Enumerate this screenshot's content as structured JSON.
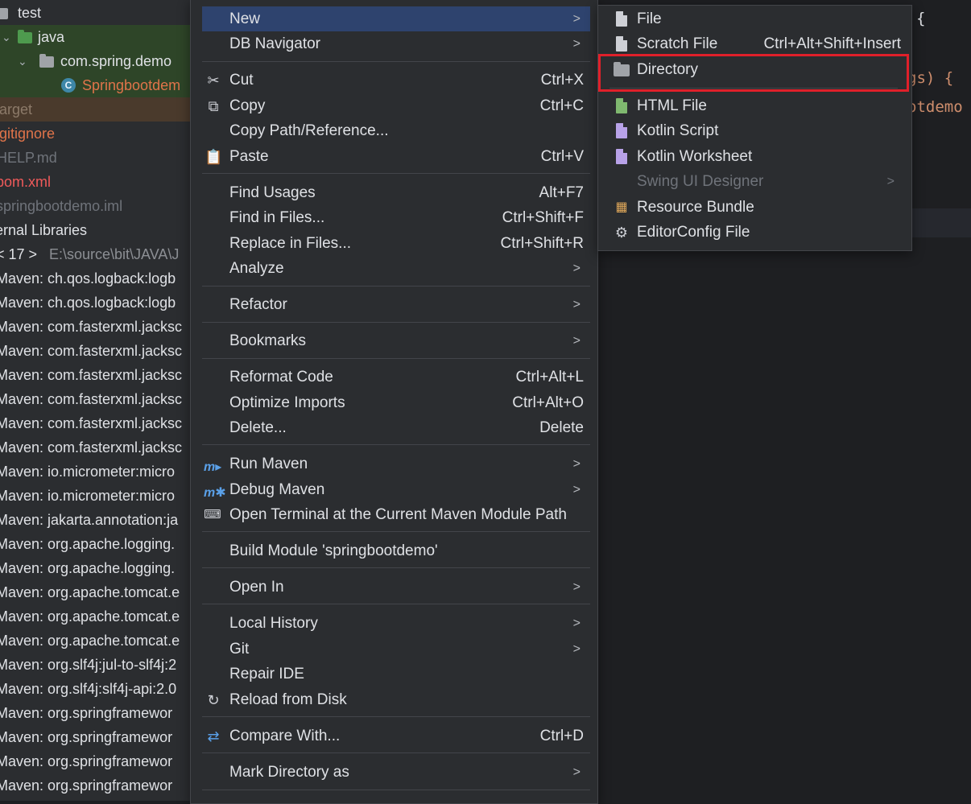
{
  "tree": {
    "rows": [
      {
        "label": "test",
        "kind": "folder"
      },
      {
        "label": "java",
        "kind": "folder-green"
      },
      {
        "label": "com.spring.demo",
        "kind": "package"
      },
      {
        "label": "Springbootdem",
        "kind": "class"
      },
      {
        "label": "target",
        "kind": "target"
      },
      {
        "label": ".gitignore",
        "kind": "file-orange"
      },
      {
        "label": "HELP.md",
        "kind": "file-gray"
      },
      {
        "label": "pom.xml",
        "kind": "file-red"
      },
      {
        "label": "springbootdemo.iml",
        "kind": "file-gray"
      },
      {
        "label": "ernal Libraries",
        "kind": "plain"
      },
      {
        "label": "< 17 >",
        "extra": "E:\\source\\bit\\JAVA\\J",
        "kind": "jdk"
      },
      {
        "label": "Maven: ch.qos.logback:logb",
        "kind": "plain"
      },
      {
        "label": "Maven: ch.qos.logback:logb",
        "kind": "plain"
      },
      {
        "label": "Maven: com.fasterxml.jacksc",
        "kind": "plain"
      },
      {
        "label": "Maven: com.fasterxml.jacksc",
        "kind": "plain"
      },
      {
        "label": "Maven: com.fasterxml.jacksc",
        "kind": "plain"
      },
      {
        "label": "Maven: com.fasterxml.jacksc",
        "kind": "plain"
      },
      {
        "label": "Maven: com.fasterxml.jacksc",
        "kind": "plain"
      },
      {
        "label": "Maven: com.fasterxml.jacksc",
        "kind": "plain"
      },
      {
        "label": "Maven: io.micrometer:micro",
        "kind": "plain"
      },
      {
        "label": "Maven: io.micrometer:micro",
        "kind": "plain"
      },
      {
        "label": "Maven: jakarta.annotation:ja",
        "kind": "plain"
      },
      {
        "label": "Maven: org.apache.logging.",
        "kind": "plain"
      },
      {
        "label": "Maven: org.apache.logging.",
        "kind": "plain"
      },
      {
        "label": "Maven: org.apache.tomcat.e",
        "kind": "plain"
      },
      {
        "label": "Maven: org.apache.tomcat.e",
        "kind": "plain"
      },
      {
        "label": "Maven: org.apache.tomcat.e",
        "kind": "plain"
      },
      {
        "label": "Maven: org.slf4j:jul-to-slf4j:2",
        "kind": "plain"
      },
      {
        "label": "Maven: org.slf4j:slf4j-api:2.0",
        "kind": "plain"
      },
      {
        "label": "Maven: org.springframewor",
        "kind": "plain"
      },
      {
        "label": "Maven: org.springframewor",
        "kind": "plain"
      },
      {
        "label": "Maven: org.springframewor",
        "kind": "plain"
      },
      {
        "label": "Maven: org.springframewor",
        "kind": "plain"
      }
    ]
  },
  "editor": {
    "line1": "{",
    "line2": "gs) {",
    "line3": "otdemo"
  },
  "context_menu": {
    "items": [
      {
        "id": "new",
        "label": "New",
        "submenu": true
      },
      {
        "id": "db-navigator",
        "label": "DB Navigator",
        "submenu": true
      },
      {
        "id": "cut",
        "label": "Cut",
        "shortcut": "Ctrl+X",
        "icon": "scissors-icon"
      },
      {
        "id": "copy",
        "label": "Copy",
        "shortcut": "Ctrl+C",
        "icon": "copy-icon"
      },
      {
        "id": "copy-path",
        "label": "Copy Path/Reference..."
      },
      {
        "id": "paste",
        "label": "Paste",
        "shortcut": "Ctrl+V",
        "icon": "clipboard-icon"
      },
      {
        "id": "find-usages",
        "label": "Find Usages",
        "shortcut": "Alt+F7"
      },
      {
        "id": "find-in-files",
        "label": "Find in Files...",
        "shortcut": "Ctrl+Shift+F"
      },
      {
        "id": "replace-in-files",
        "label": "Replace in Files...",
        "shortcut": "Ctrl+Shift+R"
      },
      {
        "id": "analyze",
        "label": "Analyze",
        "submenu": true
      },
      {
        "id": "refactor",
        "label": "Refactor",
        "submenu": true
      },
      {
        "id": "bookmarks",
        "label": "Bookmarks",
        "submenu": true
      },
      {
        "id": "reformat-code",
        "label": "Reformat Code",
        "shortcut": "Ctrl+Alt+L"
      },
      {
        "id": "optimize-imports",
        "label": "Optimize Imports",
        "shortcut": "Ctrl+Alt+O"
      },
      {
        "id": "delete",
        "label": "Delete...",
        "shortcut": "Delete"
      },
      {
        "id": "run-maven",
        "label": "Run Maven",
        "submenu": true,
        "icon": "maven-run-icon"
      },
      {
        "id": "debug-maven",
        "label": "Debug Maven",
        "submenu": true,
        "icon": "maven-debug-icon"
      },
      {
        "id": "open-terminal",
        "label": "Open Terminal at the Current Maven Module Path",
        "icon": "maven-terminal-icon"
      },
      {
        "id": "build-module",
        "label": "Build Module 'springbootdemo'"
      },
      {
        "id": "open-in",
        "label": "Open In",
        "submenu": true
      },
      {
        "id": "local-history",
        "label": "Local History",
        "submenu": true
      },
      {
        "id": "git",
        "label": "Git",
        "submenu": true
      },
      {
        "id": "repair-ide",
        "label": "Repair IDE"
      },
      {
        "id": "reload-from-disk",
        "label": "Reload from Disk",
        "icon": "reload-icon"
      },
      {
        "id": "compare-with",
        "label": "Compare With...",
        "shortcut": "Ctrl+D",
        "icon": "compare-icon"
      },
      {
        "id": "mark-directory-as",
        "label": "Mark Directory as",
        "submenu": true
      }
    ]
  },
  "new_submenu": {
    "items": [
      {
        "id": "file",
        "label": "File",
        "icon": "file-icon"
      },
      {
        "id": "scratch-file",
        "label": "Scratch File",
        "shortcut": "Ctrl+Alt+Shift+Insert",
        "icon": "scratch-file-icon"
      },
      {
        "id": "directory",
        "label": "Directory",
        "icon": "folder-icon"
      },
      {
        "id": "html-file",
        "label": "HTML File",
        "icon": "html-file-icon"
      },
      {
        "id": "kotlin-script",
        "label": "Kotlin Script",
        "icon": "kotlin-script-icon"
      },
      {
        "id": "kotlin-worksheet",
        "label": "Kotlin Worksheet",
        "icon": "kotlin-worksheet-icon"
      },
      {
        "id": "swing-ui-designer",
        "label": "Swing UI Designer",
        "submenu": true,
        "disabled": true
      },
      {
        "id": "resource-bundle",
        "label": "Resource Bundle",
        "icon": "resource-bundle-icon"
      },
      {
        "id": "editorconfig-file",
        "label": "EditorConfig File",
        "icon": "gear-icon"
      }
    ]
  },
  "arrow_glyph": ">",
  "colors": {
    "menu_bg": "#2b2d30",
    "selection": "#2e436e",
    "highlight_box": "#e0202a",
    "code_orange": "#cf8e6d"
  }
}
